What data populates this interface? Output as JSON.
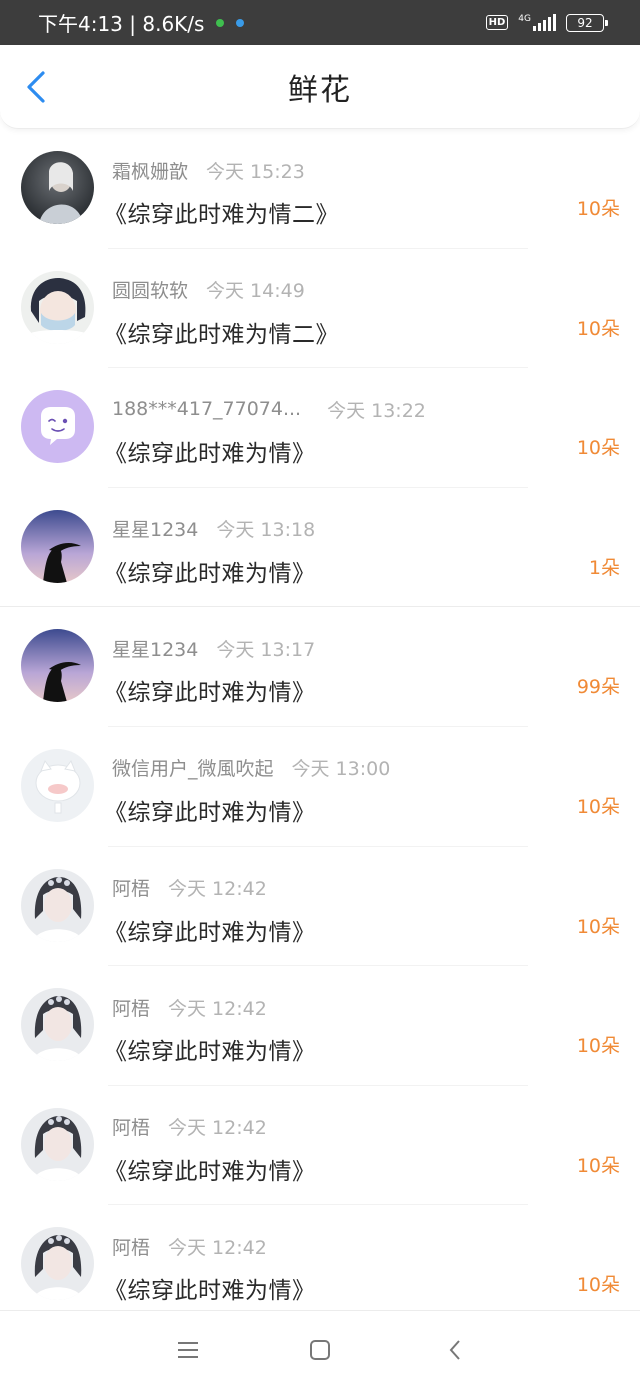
{
  "status_bar": {
    "time_speed": "下午4:13 | 8.6K/s",
    "hd": "HD",
    "network": "4G",
    "battery": "92"
  },
  "header": {
    "title": "鲜花",
    "back_icon": "chevron-left-icon",
    "accent_color": "#2d8cf0"
  },
  "items": [
    {
      "username": "霜枫姗歆",
      "time": "今天 15:23",
      "book": "《综穿此时难为情二》",
      "amount": "10朵"
    },
    {
      "username": "圆圆软软",
      "time": "今天 14:49",
      "book": "《综穿此时难为情二》",
      "amount": "10朵"
    },
    {
      "username": "188***417_77074...",
      "time": "今天 13:22",
      "book": "《综穿此时难为情》",
      "amount": "10朵"
    },
    {
      "username": "星星1234",
      "time": "今天 13:18",
      "book": "《综穿此时难为情》",
      "amount": "1朵"
    },
    {
      "username": "星星1234",
      "time": "今天 13:17",
      "book": "《综穿此时难为情》",
      "amount": "99朵"
    },
    {
      "username": "微信用户_微風吹起",
      "time": "今天 13:00",
      "book": "《综穿此时难为情》",
      "amount": "10朵"
    },
    {
      "username": "阿梧",
      "time": "今天 12:42",
      "book": "《综穿此时难为情》",
      "amount": "10朵"
    },
    {
      "username": "阿梧",
      "time": "今天 12:42",
      "book": "《综穿此时难为情》",
      "amount": "10朵"
    },
    {
      "username": "阿梧",
      "time": "今天 12:42",
      "book": "《综穿此时难为情》",
      "amount": "10朵"
    },
    {
      "username": "阿梧",
      "time": "今天 12:42",
      "book": "《综穿此时难为情》",
      "amount": "10朵"
    }
  ],
  "colors": {
    "amount": "#f08a36",
    "status_bar": "#3d3d3d"
  },
  "bottom_nav": {
    "menu_icon": "menu-icon",
    "home_icon": "home-square-icon",
    "back_icon": "back-triangle-icon"
  }
}
